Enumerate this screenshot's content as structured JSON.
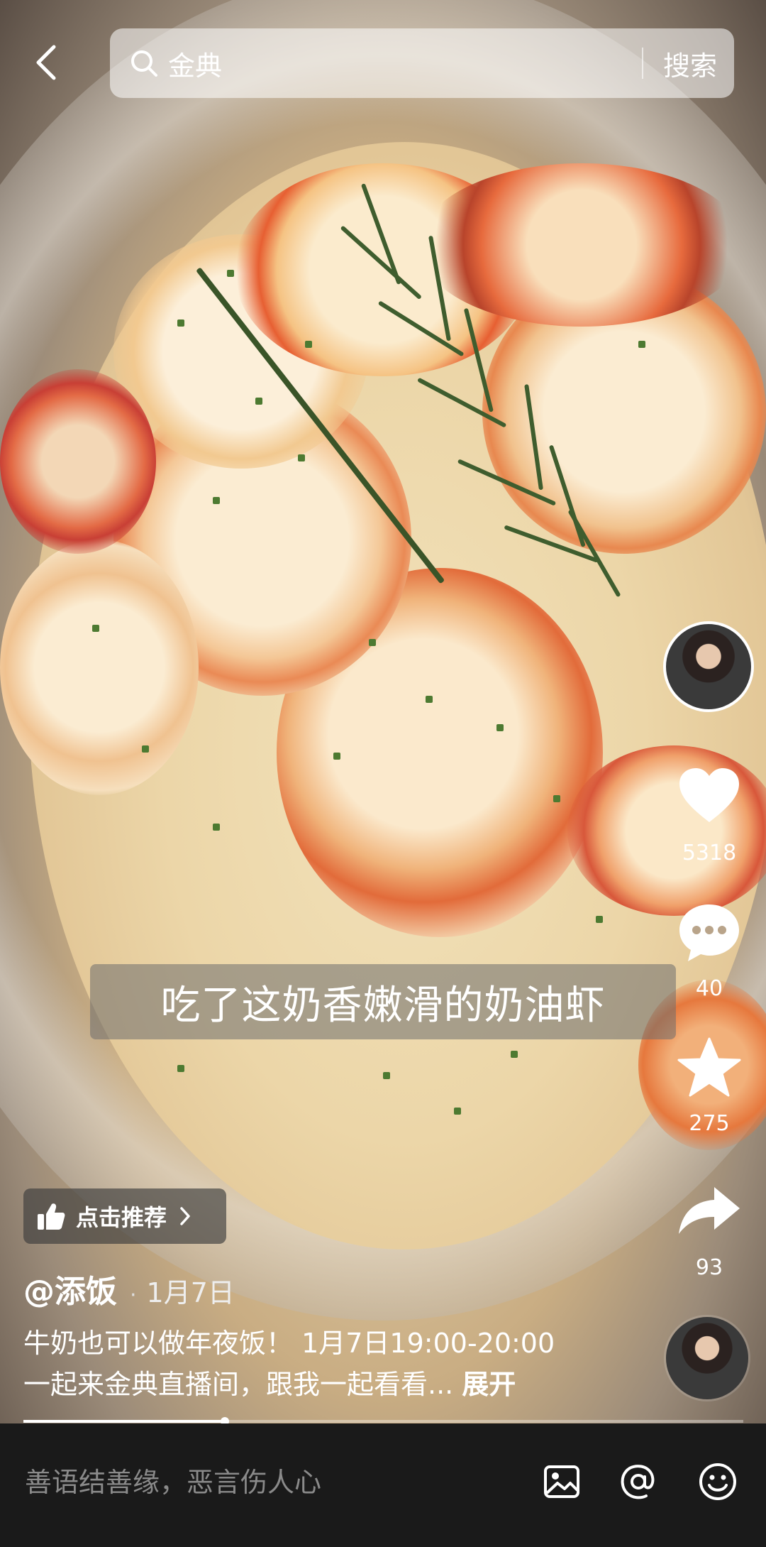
{
  "search": {
    "query": "金典",
    "button_label": "搜索"
  },
  "caption": "吃了这奶香嫩滑的奶油虾",
  "actions": {
    "likes": "5318",
    "comments": "40",
    "favorites": "275",
    "shares": "93"
  },
  "recommend": {
    "label": "点击推荐"
  },
  "post": {
    "author": "@添饭",
    "separator": "·",
    "date": "1月7日",
    "description_line1": "牛奶也可以做年夜饭！ 1月7日19:00-20:00",
    "description_line2": "一起来金典直播间，跟我一起看看...",
    "expand_label": "展开"
  },
  "video_progress": 0.28,
  "comment_bar": {
    "placeholder": "善语结善缘，恶言伤人心"
  },
  "icons": [
    "back-icon",
    "search-icon",
    "heart-icon",
    "comment-icon",
    "star-icon",
    "share-icon",
    "thumbs-up-icon",
    "chevron-right-icon",
    "image-icon",
    "at-icon",
    "emoji-icon"
  ],
  "colors": {
    "comment_bar_bg": "#1a1a1a",
    "placeholder": "#8a8a8a",
    "caption_bg": "rgba(110,110,110,0.55)"
  }
}
